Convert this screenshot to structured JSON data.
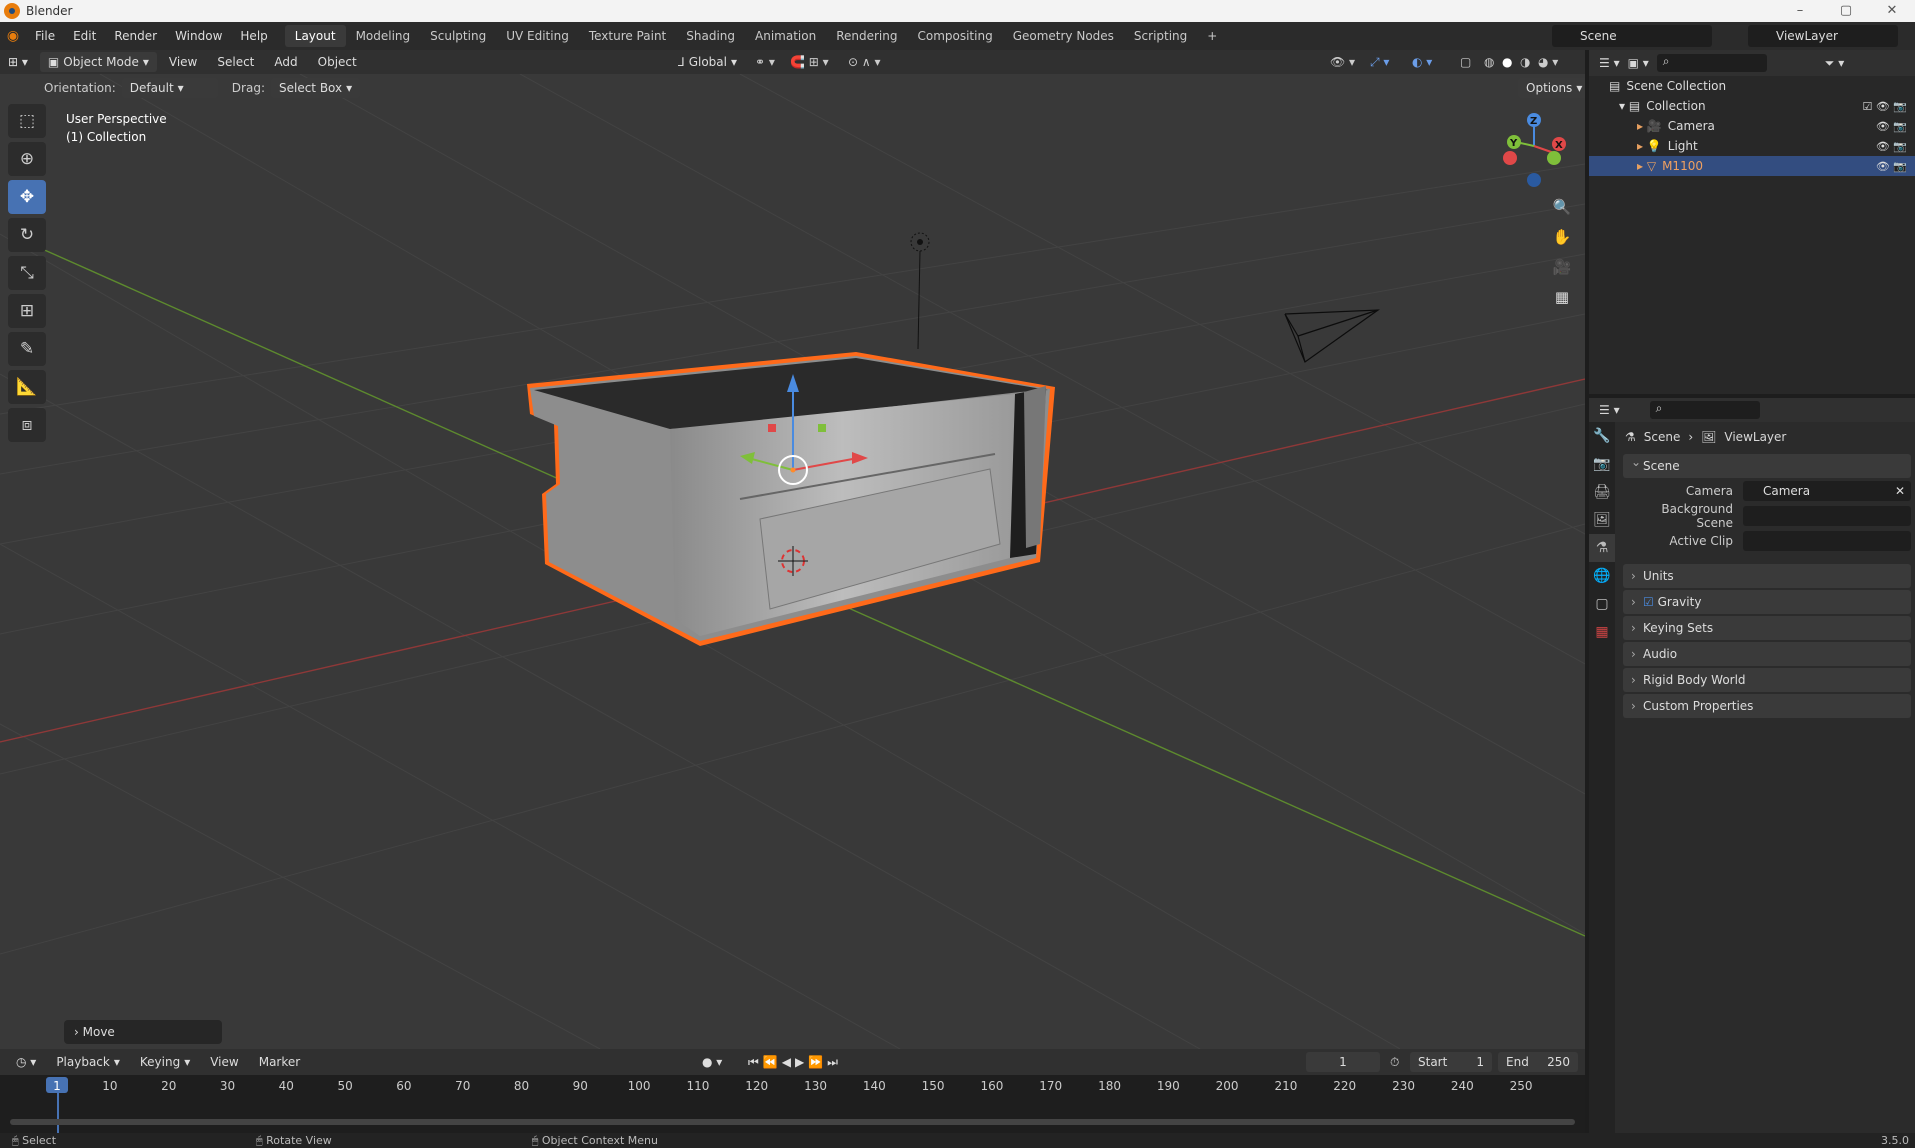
{
  "window": {
    "title": "Blender",
    "controls": [
      "–",
      "▢",
      "✕"
    ]
  },
  "menu": [
    "File",
    "Edit",
    "Render",
    "Window",
    "Help"
  ],
  "workspaces": [
    "Layout",
    "Modeling",
    "Sculpting",
    "UV Editing",
    "Texture Paint",
    "Shading",
    "Animation",
    "Rendering",
    "Compositing",
    "Geometry Nodes",
    "Scripting",
    "+"
  ],
  "active_workspace": "Layout",
  "scene": {
    "name": "Scene",
    "view_layer": "ViewLayer"
  },
  "viewport_header": {
    "mode": "Object Mode",
    "menus": [
      "View",
      "Select",
      "Add",
      "Object"
    ],
    "transform": "Global"
  },
  "tool_options": {
    "orientation_label": "Orientation:",
    "orientation_value": "Default",
    "drag_label": "Drag:",
    "drag_value": "Select Box",
    "options": "Options"
  },
  "viewport_info": {
    "line1": "User Perspective",
    "line2": "(1) Collection"
  },
  "gizmo": {
    "x": "X",
    "y": "Y",
    "z": "Z"
  },
  "last_op": "Move",
  "outliner": {
    "root": "Scene Collection",
    "collection": "Collection",
    "items": [
      {
        "name": "Camera"
      },
      {
        "name": "Light"
      },
      {
        "name": "M1100"
      }
    ]
  },
  "properties": {
    "breadcrumb_scene": "Scene",
    "breadcrumb_layer": "ViewLayer",
    "section": "Scene",
    "camera_label": "Camera",
    "camera_value": "Camera",
    "bg_label": "Background Scene",
    "clip_label": "Active Clip",
    "panels": [
      "Units",
      "Gravity",
      "Keying Sets",
      "Audio",
      "Rigid Body World",
      "Custom Properties"
    ]
  },
  "timeline": {
    "menus": [
      "Playback",
      "Keying",
      "View",
      "Marker"
    ],
    "current_frame": "1",
    "start_label": "Start",
    "start": "1",
    "end_label": "End",
    "end": "250",
    "ticks": [
      "1",
      "10",
      "20",
      "30",
      "40",
      "50",
      "60",
      "70",
      "80",
      "90",
      "100",
      "110",
      "120",
      "130",
      "140",
      "150",
      "160",
      "170",
      "180",
      "190",
      "200",
      "210",
      "220",
      "230",
      "240",
      "250"
    ]
  },
  "status": {
    "select": "Select",
    "rotate": "Rotate View",
    "context": "Object Context Menu",
    "version": "3.5.0"
  }
}
